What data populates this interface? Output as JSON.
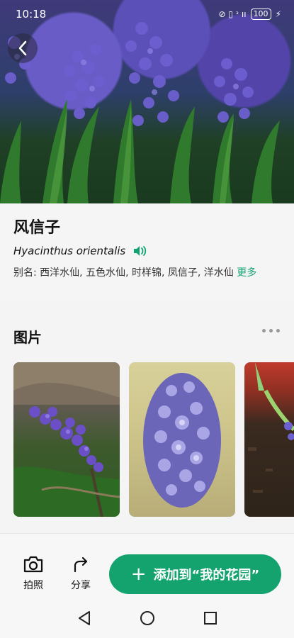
{
  "status_bar": {
    "time": "10:18",
    "battery": "100",
    "signal_icons": "⊘ ▯ ᵌ ıı"
  },
  "plant": {
    "name": "风信子",
    "scientific_name": "Hyacinthus orientalis",
    "alias_text": "别名: 西洋水仙, 五色水仙, 时样锦, 凤信子, 洋水仙 ",
    "more_label": "更多"
  },
  "photos": {
    "title": "图片"
  },
  "bottom_bar": {
    "camera_label": "拍照",
    "share_label": "分享",
    "add_label": "添加到“我的花园”"
  },
  "colors": {
    "accent": "#14a36f",
    "link": "#11a374"
  }
}
